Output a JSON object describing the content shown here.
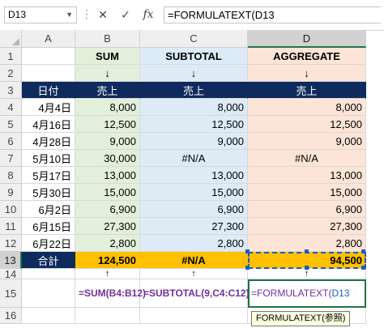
{
  "formula_bar": {
    "name_box": "D13",
    "cancel_icon": "✕",
    "enter_icon": "✓",
    "fx_label": "fx",
    "formula": "=FORMULATEXT(D13"
  },
  "columns": [
    "A",
    "B",
    "C",
    "D"
  ],
  "rows": [
    "1",
    "2",
    "3",
    "4",
    "5",
    "6",
    "7",
    "8",
    "9",
    "10",
    "11",
    "12",
    "13",
    "14",
    "15",
    "16"
  ],
  "headers": {
    "sum": "SUM",
    "subtotal": "SUBTOTAL",
    "aggregate": "AGGREGATE"
  },
  "arrow": "↓",
  "up_arrow": "↑",
  "table_header": {
    "date": "日付",
    "b": "売上",
    "c": "売上",
    "d": "売上"
  },
  "data_rows": [
    {
      "date": "4月4日",
      "b": "8,000",
      "c": "8,000",
      "d": "8,000"
    },
    {
      "date": "4月16日",
      "b": "12,500",
      "c": "12,500",
      "d": "12,500"
    },
    {
      "date": "4月28日",
      "b": "9,000",
      "c": "9,000",
      "d": "9,000"
    },
    {
      "date": "5月10日",
      "b": "30,000",
      "c": "#N/A",
      "d": "#N/A"
    },
    {
      "date": "5月17日",
      "b": "13,000",
      "c": "13,000",
      "d": "13,000"
    },
    {
      "date": "5月30日",
      "b": "15,000",
      "c": "15,000",
      "d": "15,000"
    },
    {
      "date": "6月2日",
      "b": "6,900",
      "c": "6,900",
      "d": "6,900"
    },
    {
      "date": "6月15日",
      "b": "27,300",
      "c": "27,300",
      "d": "27,300"
    },
    {
      "date": "6月22日",
      "b": "2,800",
      "c": "2,800",
      "d": "2,800"
    }
  ],
  "total": {
    "label": "合計",
    "b": "124,500",
    "c": "#N/A",
    "d": "94,500"
  },
  "formulas": {
    "b": "=SUM(B4:B12)",
    "c": "=SUBTOTAL(9,C4:C12)",
    "d_prefix": "=FORMULATEXT(",
    "d_ref": "D13"
  },
  "tooltip": {
    "fn": "FORMULATEXT(",
    "arg": "参照",
    "close": ")"
  },
  "colors": {
    "sum_fill": "#e2efda",
    "subtotal_fill": "#ddebf7",
    "aggregate_fill": "#fce4d6",
    "header_fill": "#0f2a5c",
    "total_fill": "#ffc000",
    "formula_text": "#7030a0",
    "selection": "#217346",
    "reference": "#1e5bc6"
  }
}
